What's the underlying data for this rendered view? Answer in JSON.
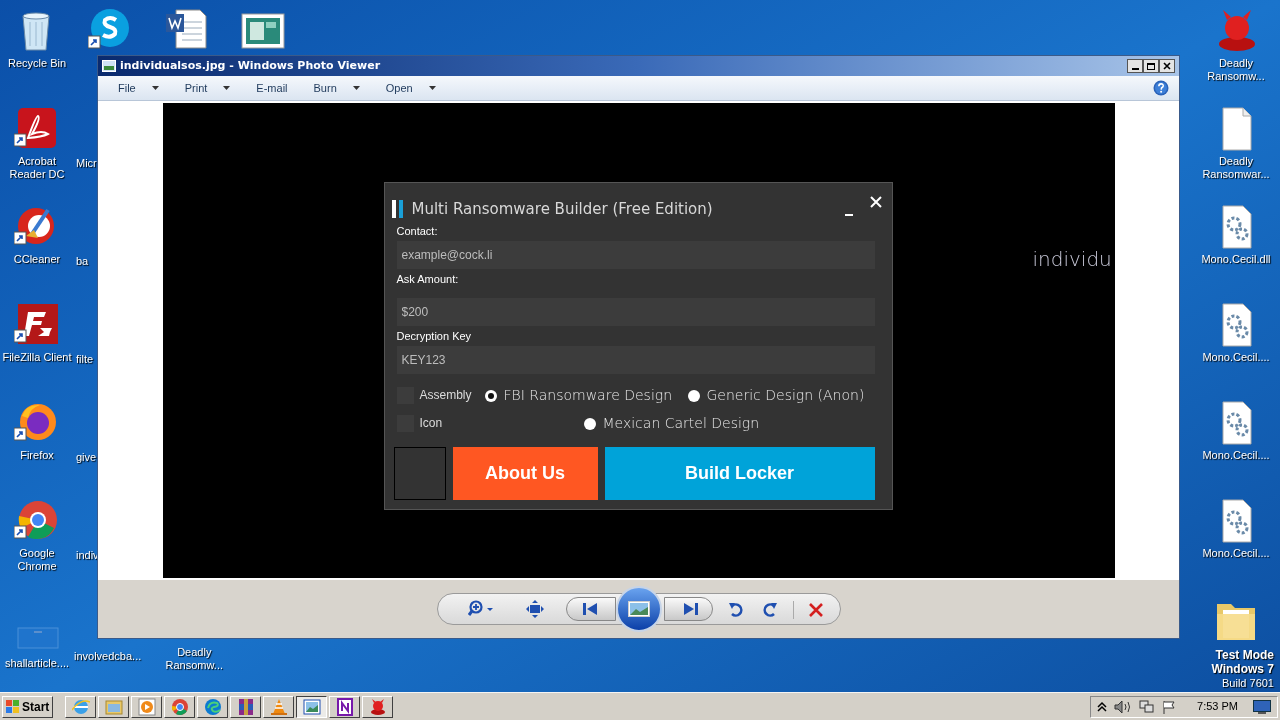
{
  "desktop_left": [
    {
      "label": "Recycle Bin",
      "kind": "recycle"
    },
    {
      "label": "Acrobat Reader DC",
      "kind": "acrobat"
    },
    {
      "label": "CCleaner",
      "kind": "ccleaner"
    },
    {
      "label": "FileZilla Client",
      "kind": "filezilla"
    },
    {
      "label": "Firefox",
      "kind": "firefox"
    },
    {
      "label": "Google Chrome",
      "kind": "chrome"
    },
    {
      "label": "shallarticle....",
      "kind": "blank"
    }
  ],
  "desktop_partial": [
    {
      "label": "Micr"
    },
    {
      "label": "ba"
    },
    {
      "label": "filte"
    },
    {
      "label": "give"
    },
    {
      "label": "indiv"
    }
  ],
  "desktop_top": [
    {
      "kind": "skype"
    },
    {
      "kind": "word"
    },
    {
      "kind": "picture"
    }
  ],
  "desktop_bottom": [
    {
      "label": "involvedcba..."
    },
    {
      "label": "Deadly Ransomw..."
    }
  ],
  "desktop_right": [
    {
      "label": "Deadly Ransomw...",
      "kind": "devil"
    },
    {
      "label": "Deadly Ransomwar...",
      "kind": "file"
    },
    {
      "label": "Mono.Cecil.dll",
      "kind": "dll"
    },
    {
      "label": "Mono.Cecil....",
      "kind": "dll"
    },
    {
      "label": "Mono.Cecil....",
      "kind": "dll"
    },
    {
      "label": "Mono.Cecil....",
      "kind": "dll"
    },
    {
      "kind": "folder"
    }
  ],
  "window": {
    "title": "individualsos.jpg - Windows Photo Viewer",
    "menu": [
      {
        "label": "File",
        "dropdown": true
      },
      {
        "label": "Print",
        "dropdown": true
      },
      {
        "label": "E-mail",
        "dropdown": false
      },
      {
        "label": "Burn",
        "dropdown": true
      },
      {
        "label": "Open",
        "dropdown": true
      }
    ]
  },
  "photo": {
    "side_text": "individu",
    "dialog": {
      "title": "Multi Ransomware Builder (Free Edition)",
      "fields": [
        {
          "label": "Contact:",
          "value": "example@cock.li"
        },
        {
          "label": "Ask Amount:",
          "value": "$200"
        },
        {
          "label": "Decryption Key",
          "value": "KEY123"
        }
      ],
      "checkboxes": [
        {
          "label": "Assembly",
          "checked": false
        },
        {
          "label": "Icon",
          "checked": false
        }
      ],
      "radios": [
        {
          "label": "FBI Ransomware Design",
          "selected": true
        },
        {
          "label": "Generic Design (Anon)",
          "selected": false
        },
        {
          "label": "Mexican Cartel Design",
          "selected": false
        }
      ],
      "buttons": [
        {
          "label": "About Us",
          "kind": "about"
        },
        {
          "label": "Build Locker",
          "kind": "build"
        }
      ]
    }
  },
  "watermark": [
    "Test Mode",
    "Windows 7",
    "Build 7601"
  ],
  "taskbar": {
    "start": "Start",
    "apps": [
      {
        "kind": "ie",
        "active": false
      },
      {
        "kind": "explorer",
        "active": false
      },
      {
        "kind": "media",
        "active": false
      },
      {
        "kind": "chrome",
        "active": false
      },
      {
        "kind": "edge",
        "active": false
      },
      {
        "kind": "winrar",
        "active": false
      },
      {
        "kind": "vlc",
        "active": false
      },
      {
        "kind": "photos",
        "active": true
      },
      {
        "kind": "onenote",
        "active": false
      },
      {
        "kind": "devil",
        "active": false
      }
    ],
    "time": "7:53 PM"
  }
}
